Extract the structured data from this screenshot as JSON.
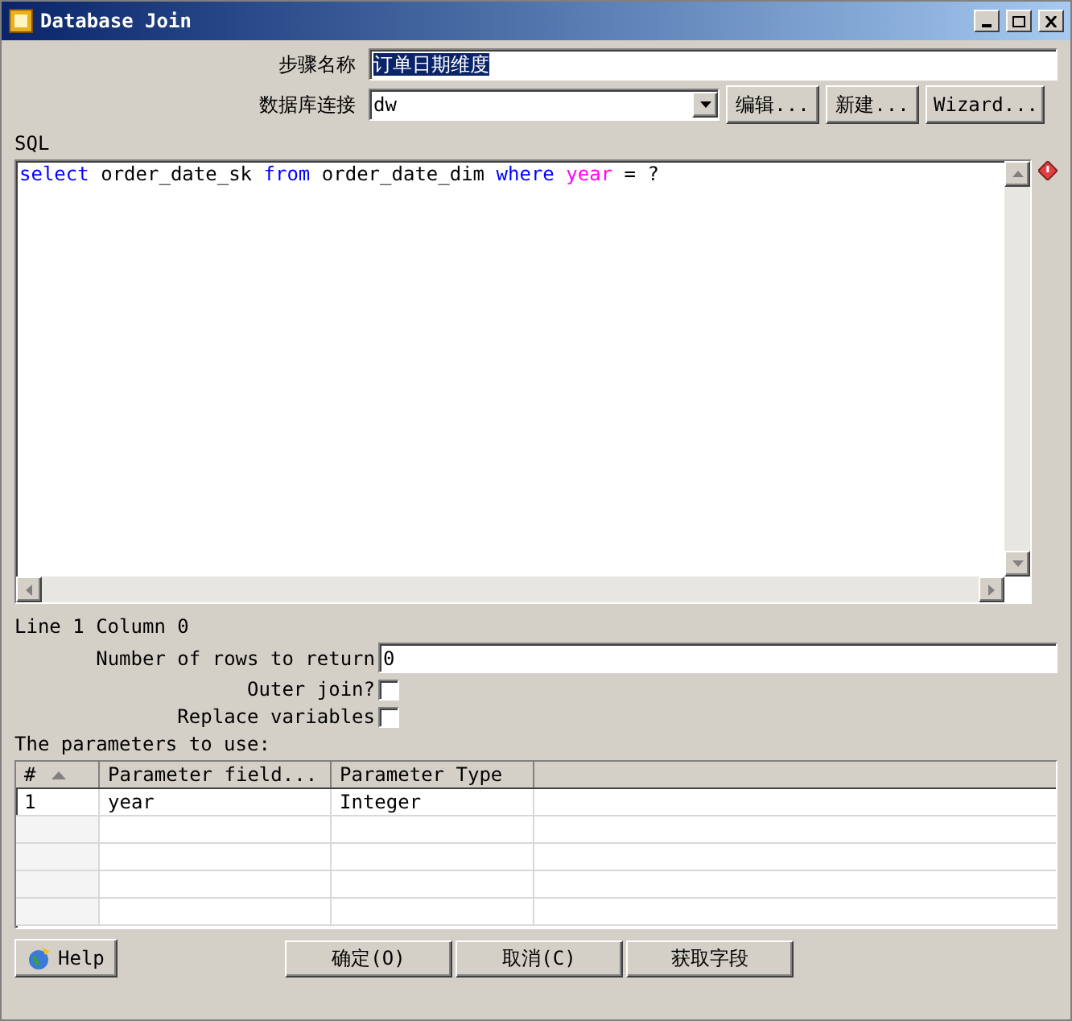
{
  "window": {
    "title": "Database Join"
  },
  "step_name": {
    "label": "步骤名称",
    "value": "订单日期维度"
  },
  "connection": {
    "label": "数据库连接",
    "value": "dw",
    "buttons": [
      "编辑...",
      "新建...",
      "Wizard..."
    ]
  },
  "sql": {
    "label": "SQL",
    "tokens": [
      {
        "kind": "keyword",
        "text": "select"
      },
      {
        "kind": "plain",
        "text": "order_date_sk"
      },
      {
        "kind": "keyword",
        "text": "from"
      },
      {
        "kind": "plain",
        "text": "order_date_dim"
      },
      {
        "kind": "keyword",
        "text": "where"
      },
      {
        "kind": "field",
        "text": "year"
      },
      {
        "kind": "plain",
        "text": "= ?"
      }
    ]
  },
  "cursor_position": "Line 1 Column 0",
  "rows_to_return": {
    "label": "Number of rows to return",
    "value": "0"
  },
  "options": [
    {
      "label": "Outer join?",
      "checked": false
    },
    {
      "label": "Replace variables",
      "checked": false
    }
  ],
  "parameters": {
    "label": "The parameters to use:",
    "columns": [
      "#",
      "Parameter field...",
      "Parameter Type"
    ],
    "rows": [
      [
        "1",
        "year",
        "Integer"
      ]
    ]
  },
  "buttons": {
    "help": "Help",
    "actions": [
      "确定(O)",
      "取消(C)",
      "获取字段"
    ]
  }
}
